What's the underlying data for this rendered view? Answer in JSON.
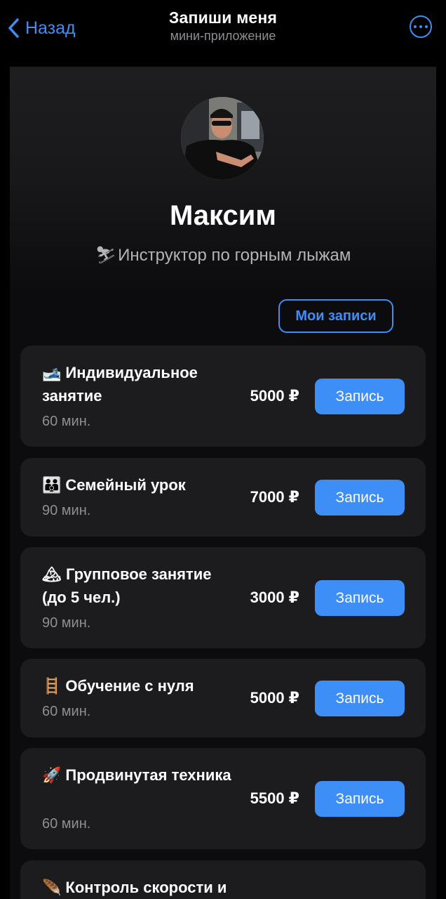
{
  "nav": {
    "back_label": "Назад",
    "title": "Запиши меня",
    "subtitle": "мини-приложение"
  },
  "profile": {
    "name": "Максим",
    "role_emoji": "⛷",
    "role": "Инструктор по горным лыжам"
  },
  "my_bookings_label": "Мои записи",
  "accent_color": "#3e8ef7",
  "services": [
    {
      "icon": "🎿",
      "title": "Индивидуальное занятие",
      "duration": "60 мин.",
      "price": "5000 ₽",
      "button": "Запись"
    },
    {
      "icon": "👪",
      "title": "Семейный урок",
      "duration": "90 мин.",
      "price": "7000 ₽",
      "button": "Запись"
    },
    {
      "icon": "🏔",
      "title": "Групповое занятие (до 5 чел.)",
      "duration": "90 мин.",
      "price": "3000 ₽",
      "button": "Запись"
    },
    {
      "icon": "🪜",
      "title": "Обучение с нуля",
      "duration": "60 мин.",
      "price": "5000 ₽",
      "button": "Запись"
    },
    {
      "icon": "🚀",
      "title": "Продвинутая техника",
      "duration": "60 мин.",
      "price": "5500 ₽",
      "button": "Запись"
    },
    {
      "icon": "🪶",
      "title": "Контроль скорости и"
    }
  ]
}
